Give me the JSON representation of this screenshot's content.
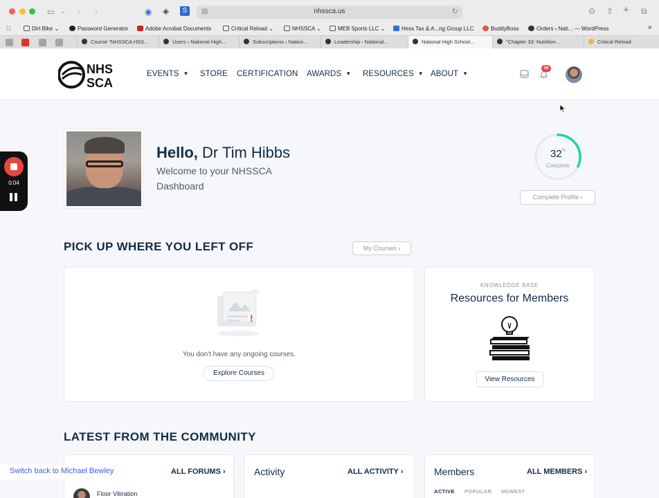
{
  "browser": {
    "url": "nhssca.us",
    "bookmarks": [
      "Dirt Bike",
      "Password Generator",
      "Adobe Acrobat Documents",
      "Critical Reload",
      "NHSSCA",
      "MEB Sports LLC",
      "Hess Tax & A...ng Group LLC",
      "BuddyBoss",
      "Orders ‹ Nati... — WordPress"
    ],
    "tabs": [
      "Course \"NHSSCA HSS...",
      "Users ‹ National High...",
      "Subscriptions ‹ Nation...",
      "Leadership - National...",
      "National High School...",
      "\"Chapter 33: Nutrition...",
      "Critical Reload"
    ],
    "active_tab_index": 4
  },
  "site": {
    "logo_text_top": "NHS",
    "logo_text_bottom": "SCA",
    "nav": [
      "EVENTS",
      "STORE",
      "CERTIFICATION",
      "AWARDS",
      "RESOURCES",
      "ABOUT"
    ],
    "notification_count": "36"
  },
  "recorder": {
    "time": "0:04"
  },
  "profile": {
    "greeting": "Hello,",
    "name": "Dr Tim Hibbs",
    "welcome": "Welcome to your NHSSCA Dashboard",
    "progress_value": "32",
    "progress_unit": "%",
    "progress_fraction": 0.32,
    "progress_label": "Complete",
    "complete_profile_btn": "Complete Profile"
  },
  "courses": {
    "title": "PICK UP WHERE YOU LEFT OFF",
    "my_courses_btn": "My Courses",
    "empty_message": "You don't have any ongoing courses.",
    "explore_btn": "Explore Courses"
  },
  "knowledge": {
    "label": "KNOWLEDGE BASE",
    "title": "Resources for Members",
    "view_btn": "View Resources"
  },
  "community": {
    "title": "LATEST FROM THE COMMUNITY",
    "forums_link": "ALL FORUMS",
    "activity_title": "Activity",
    "activity_link": "ALL ACTIVITY",
    "members_title": "Members",
    "members_link": "ALL MEMBERS",
    "member_tabs": [
      "ACTIVE",
      "POPULAR",
      "NEWEST"
    ],
    "forum_item": "Floor Vibration"
  },
  "switch_back": "Switch back to Michael Bewley",
  "colors": {
    "navy": "#122b46",
    "progress": "#1cd991",
    "badge": "#ef3e46",
    "link": "#385dff"
  }
}
